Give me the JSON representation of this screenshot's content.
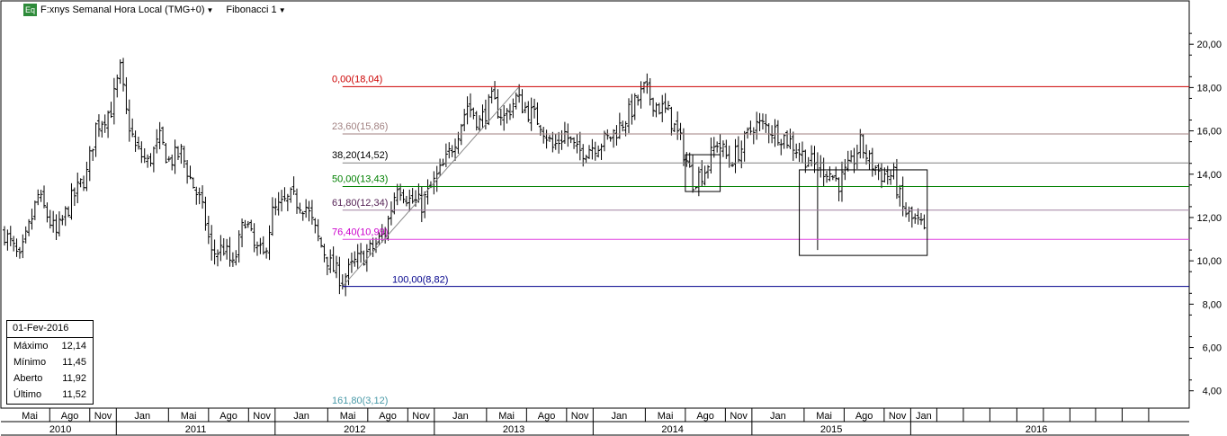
{
  "header": {
    "badge": "Eq",
    "title": "F:xnys Semanal Hora Local (TMG+0)",
    "tool": "Fibonacci 1"
  },
  "info_box": {
    "date": "01-Fev-2016",
    "rows": [
      {
        "label": "Máximo",
        "value": "12,14"
      },
      {
        "label": "Mínimo",
        "value": "11,45"
      },
      {
        "label": "Aberto",
        "value": "11,92"
      },
      {
        "label": "Último",
        "value": "11,52"
      }
    ]
  },
  "colors": {
    "price_bars": "#000000",
    "grid": "#c8c8c8",
    "fib_0": "#cc0000",
    "fib_236": "#a08080",
    "fib_382": "#808080",
    "fib_50": "#008000",
    "fib_618": "#a080a0",
    "fib_764": "#e040e0",
    "fib_100": "#00008b",
    "fib_1618": "#4a9aa8"
  },
  "chart_data": {
    "type": "ohlc",
    "title": "",
    "y_axis": {
      "position": "right",
      "ylim": [
        3.2,
        22.0
      ],
      "ticks": [
        4,
        6,
        8,
        10,
        12,
        14,
        16,
        18,
        20
      ],
      "tick_labels": [
        "4,00",
        "6,00",
        "8,00",
        "10,00",
        "12,00",
        "14,00",
        "16,00",
        "18,00",
        "20,00"
      ]
    },
    "x_axis": {
      "start": "2010-04-19",
      "end": "2016-04-25",
      "month_labels": [
        {
          "date": "2010-05-01",
          "label": "Mai"
        },
        {
          "date": "2010-08-01",
          "label": "Ago"
        },
        {
          "date": "2010-11-01",
          "label": "Nov"
        },
        {
          "date": "2011-01-01",
          "label": "Jan"
        },
        {
          "date": "2011-05-01",
          "label": "Mai"
        },
        {
          "date": "2011-08-01",
          "label": "Ago"
        },
        {
          "date": "2011-11-01",
          "label": "Nov"
        },
        {
          "date": "2012-01-01",
          "label": "Jan"
        },
        {
          "date": "2012-05-01",
          "label": "Mai"
        },
        {
          "date": "2012-08-01",
          "label": "Ago"
        },
        {
          "date": "2012-11-01",
          "label": "Nov"
        },
        {
          "date": "2013-01-01",
          "label": "Jan"
        },
        {
          "date": "2013-05-01",
          "label": "Mai"
        },
        {
          "date": "2013-08-01",
          "label": "Ago"
        },
        {
          "date": "2013-11-01",
          "label": "Nov"
        },
        {
          "date": "2014-01-01",
          "label": "Jan"
        },
        {
          "date": "2014-05-01",
          "label": "Mai"
        },
        {
          "date": "2014-08-01",
          "label": "Ago"
        },
        {
          "date": "2014-11-01",
          "label": "Nov"
        },
        {
          "date": "2015-01-01",
          "label": "Jan"
        },
        {
          "date": "2015-05-01",
          "label": "Mai"
        },
        {
          "date": "2015-08-01",
          "label": "Ago"
        },
        {
          "date": "2015-11-01",
          "label": "Nov"
        },
        {
          "date": "2016-01-01",
          "label": "Jan"
        }
      ],
      "blank_divisions": [
        "2016-03-01",
        "2016-05-01",
        "2016-07-01",
        "2016-09-01",
        "2016-11-01",
        "2017-01-01",
        "2017-03-01",
        "2017-05-01",
        "2017-07-01"
      ],
      "year_labels": [
        {
          "label": "2010",
          "from": "2010-04-19",
          "to": "2011-01-01"
        },
        {
          "label": "2011",
          "from": "2011-01-01",
          "to": "2012-01-01"
        },
        {
          "label": "2012",
          "from": "2012-01-01",
          "to": "2013-01-01"
        },
        {
          "label": "2013",
          "from": "2013-01-01",
          "to": "2014-01-01"
        },
        {
          "label": "2014",
          "from": "2014-01-01",
          "to": "2015-01-01"
        },
        {
          "label": "2015",
          "from": "2015-01-01",
          "to": "2016-01-01"
        },
        {
          "label": "2016",
          "from": "2016-01-01",
          "to": "2017-08-01"
        }
      ]
    },
    "fibonacci": {
      "from": "2012-06-04",
      "to": "2016-02-01",
      "levels": [
        {
          "label": "0,00(18,04)",
          "value": 18.04,
          "color": "#cc0000"
        },
        {
          "label": "23,60(15,86)",
          "value": 15.86,
          "color": "#a08080"
        },
        {
          "label": "38,20(14,52)",
          "value": 14.52,
          "color": "#808080",
          "text_color": "#000000"
        },
        {
          "label": "50,00(13,43)",
          "value": 13.43,
          "color": "#008000"
        },
        {
          "label": "61,80(12,34)",
          "value": 12.34,
          "color": "#a080a0",
          "text_color": "#552255"
        },
        {
          "label": "76,40(10,99)",
          "value": 10.99,
          "color": "#e040e0",
          "text_color": "#cc00cc"
        },
        {
          "label": "100,00(8,82)",
          "value": 8.82,
          "color": "#00008b"
        },
        {
          "label": "161,80(3,12)",
          "value": 3.12,
          "color": "#4a9aa8"
        }
      ],
      "trendline": {
        "from": [
          "2012-06-04",
          8.82
        ],
        "to": [
          "2013-07-15",
          18.04
        ]
      }
    },
    "annotation_boxes": [
      {
        "from": "2014-08-01",
        "to": "2014-10-20",
        "ymin": 13.2,
        "ymax": 14.9
      },
      {
        "from": "2015-04-20",
        "to": "2016-02-08",
        "ymin": 10.25,
        "ymax": 14.2
      }
    ],
    "anchors": [
      [
        "2010-04-19",
        11.3
      ],
      [
        "2010-05-24",
        10.0
      ],
      [
        "2010-07-05",
        13.0
      ],
      [
        "2010-08-16",
        11.2
      ],
      [
        "2010-09-20",
        12.8
      ],
      [
        "2010-10-25",
        14.0
      ],
      [
        "2010-11-15",
        16.2
      ],
      [
        "2010-12-20",
        17.0
      ],
      [
        "2011-01-10",
        18.8
      ],
      [
        "2011-01-24",
        16.8
      ],
      [
        "2011-02-14",
        15.2
      ],
      [
        "2011-03-14",
        14.5
      ],
      [
        "2011-04-11",
        15.6
      ],
      [
        "2011-05-02",
        14.6
      ],
      [
        "2011-05-30",
        15.0
      ],
      [
        "2011-06-20",
        13.8
      ],
      [
        "2011-07-11",
        12.8
      ],
      [
        "2011-07-25",
        11.8
      ],
      [
        "2011-08-08",
        10.3
      ],
      [
        "2011-09-05",
        10.6
      ],
      [
        "2011-09-26",
        9.7
      ],
      [
        "2011-10-24",
        12.0
      ],
      [
        "2011-11-14",
        10.6
      ],
      [
        "2011-12-05",
        10.2
      ],
      [
        "2011-12-26",
        12.2
      ],
      [
        "2012-02-06",
        12.9
      ],
      [
        "2012-03-12",
        12.5
      ],
      [
        "2012-04-09",
        11.0
      ],
      [
        "2012-05-07",
        9.8
      ],
      [
        "2012-06-04",
        9.1
      ],
      [
        "2012-07-02",
        9.9
      ],
      [
        "2012-08-13",
        10.6
      ],
      [
        "2012-09-10",
        11.3
      ],
      [
        "2012-10-08",
        13.6
      ],
      [
        "2012-11-05",
        12.8
      ],
      [
        "2012-12-03",
        12.6
      ],
      [
        "2012-12-31",
        13.6
      ],
      [
        "2013-01-28",
        14.6
      ],
      [
        "2013-02-25",
        16.0
      ],
      [
        "2013-03-18",
        17.2
      ],
      [
        "2013-04-15",
        16.4
      ],
      [
        "2013-05-13",
        17.4
      ],
      [
        "2013-06-10",
        16.6
      ],
      [
        "2013-07-08",
        17.5
      ],
      [
        "2013-08-05",
        16.9
      ],
      [
        "2013-09-02",
        16.4
      ],
      [
        "2013-09-30",
        15.2
      ],
      [
        "2013-10-28",
        15.9
      ],
      [
        "2013-11-25",
        15.0
      ],
      [
        "2013-12-30",
        15.3
      ],
      [
        "2014-02-03",
        15.6
      ],
      [
        "2014-03-03",
        16.2
      ],
      [
        "2014-03-31",
        17.0
      ],
      [
        "2014-04-28",
        17.9
      ],
      [
        "2014-05-26",
        17.2
      ],
      [
        "2014-06-23",
        16.8
      ],
      [
        "2014-07-21",
        15.5
      ],
      [
        "2014-08-18",
        13.7
      ],
      [
        "2014-09-15",
        14.2
      ],
      [
        "2014-10-13",
        15.5
      ],
      [
        "2014-11-10",
        14.6
      ],
      [
        "2014-12-08",
        15.2
      ],
      [
        "2015-01-05",
        16.3
      ],
      [
        "2015-02-02",
        16.2
      ],
      [
        "2015-03-02",
        15.9
      ],
      [
        "2015-03-30",
        15.5
      ],
      [
        "2015-04-27",
        14.9
      ],
      [
        "2015-05-25",
        14.4
      ],
      [
        "2015-06-22",
        14.2
      ],
      [
        "2015-07-20",
        13.6
      ],
      [
        "2015-08-17",
        14.4
      ],
      [
        "2015-09-07",
        15.4
      ],
      [
        "2015-09-28",
        14.6
      ],
      [
        "2015-10-26",
        14.0
      ],
      [
        "2015-11-23",
        13.9
      ],
      [
        "2015-12-14",
        12.4
      ],
      [
        "2016-01-04",
        11.9
      ],
      [
        "2016-02-01",
        11.52
      ]
    ],
    "spikes": [
      {
        "date": "2015-06-01",
        "low": 10.5
      },
      {
        "date": "2014-08-25",
        "low": 13.3
      }
    ],
    "last_bar": {
      "date": "2016-02-01",
      "high": 12.14,
      "low": 11.45,
      "open": 11.92,
      "close": 11.52
    }
  }
}
